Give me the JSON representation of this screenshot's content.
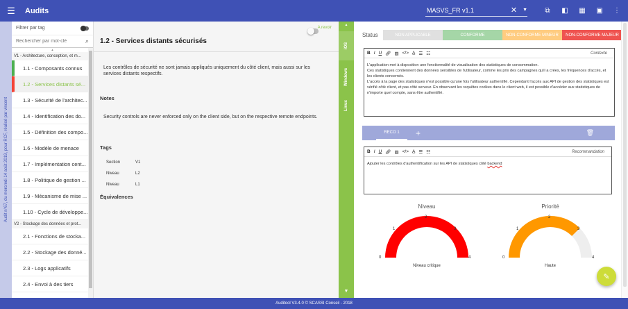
{
  "topbar": {
    "title": "Audits",
    "version_value": "MASVS_FR v1.1",
    "icons": [
      "menu-icon",
      "copy-icon",
      "view-icon",
      "table-icon",
      "comment-icon",
      "more-icon"
    ]
  },
  "vband_text": "Audit n°67, du mercredi 14 août 2019, pour RCF, réalisé par vincent",
  "sidebar": {
    "filter_label": "Filtrer par tag",
    "search_placeholder": "Rechercher par mot-clé",
    "sections": [
      {
        "title": "V1 - Architecture, conception, et m...",
        "items": [
          {
            "label": "1.1 - Composants connus"
          },
          {
            "label": "1.2 - Services distants sé..."
          },
          {
            "label": "1.3 - Sécurité de l'architec..."
          },
          {
            "label": "1.4 - Identification des do..."
          },
          {
            "label": "1.5 - Définition des compo..."
          },
          {
            "label": "1.6 - Modèle de menace"
          },
          {
            "label": "1.7 - Implémentation cent..."
          },
          {
            "label": "1.8 - Politique de gestion ..."
          },
          {
            "label": "1.9 - Mécanisme de mise ..."
          },
          {
            "label": "1.10 - Cycle de développe..."
          }
        ]
      },
      {
        "title": "V2 - Stockage des données et prot...",
        "items": [
          {
            "label": "2.1 - Fonctions de stocka..."
          },
          {
            "label": "2.2 - Stockage des donné..."
          },
          {
            "label": "2.3 - Logs applicatifs"
          },
          {
            "label": "2.4 - Envoi à des tiers"
          }
        ]
      }
    ]
  },
  "middle": {
    "a_revoir": "A revoir",
    "title": "1.2 - Services distants sécurisés",
    "description": "Les contrôles de sécurité ne sont jamais appliqués uniquement du côté client, mais aussi sur les services distants respectifs.",
    "notes_heading": "Notes",
    "notes_text": "Security controls are never enforced only on the client side, but on the respective remote endpoints.",
    "tags_heading": "Tags",
    "tags": [
      {
        "key": "Section",
        "value": "V1"
      },
      {
        "key": "Niveau",
        "value": "L2"
      },
      {
        "key": "Niveau",
        "value": "L1"
      }
    ],
    "equivalences_heading": "Équivalences"
  },
  "vtabs": [
    "iOS",
    "Windows",
    "Linux"
  ],
  "right": {
    "status_label": "Status",
    "status_options": [
      {
        "label": "NON APPLICABLE",
        "color": "#e0e0e0"
      },
      {
        "label": "CONFORME",
        "color": "#a5d6a7"
      },
      {
        "label": "NON-CONFORME MINEUR",
        "color": "#ffcc80"
      },
      {
        "label": "NON-CONFORME MAJEUR",
        "color": "#ef5350"
      }
    ],
    "context_placeholder": "Contexte",
    "context_text": "L'application met à disposition une fonctionnalité de visualisation des statistiques de consommation.\nCes statistiques contiennent des données sensibles de l'utilisateur, comme les prix des campagnes qu'il a crées, les fréquences d'accès, et les clients concernés.\nL'accès à la page des statistiques n'est possible qu'une fois l'utilisateur authentifié. Cependant l'accès aux API de gestion des statistiques est vérifié côté client, et pas côté serveur. En observant les requêtes codées dans le client web, il est possible d'accéder aux statistiques de n'importe quel compte, sans être authentifié.",
    "reco_tab": "RECO 1",
    "reco_placeholder": "Recommandation",
    "reco_text_before": "Ajouter les contrôles d'authentification sur les API de statistiques côté ",
    "reco_text_spell": "backend",
    "gauges": [
      {
        "title": "Niveau",
        "subtitle": "Niveau critique",
        "value": 4,
        "max": 4,
        "color": "#ff0000",
        "ticks": [
          "0",
          "1",
          "2",
          "3",
          "4"
        ]
      },
      {
        "title": "Priorité",
        "subtitle": "Haute",
        "value": 3,
        "max": 4,
        "color": "#ff9800",
        "ticks": [
          "0",
          "1",
          "2",
          "3",
          "4"
        ]
      }
    ]
  },
  "footer": "Auditool V3.4.0 © SCASSI Conseil - 2018"
}
